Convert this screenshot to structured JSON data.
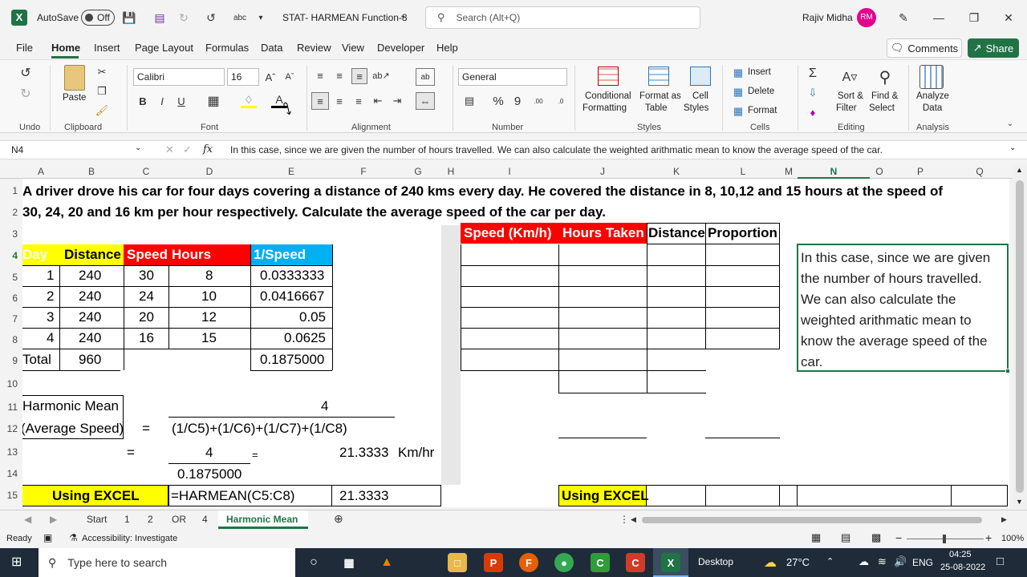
{
  "titlebar": {
    "autosave_label": "AutoSave",
    "autosave_state": "Off",
    "doc_title": "STAT- HARMEAN Function-8",
    "search_placeholder": "Search (Alt+Q)",
    "user_name": "Rajiv Midha",
    "user_initials": "RM"
  },
  "menu": {
    "tabs": [
      "File",
      "Home",
      "Insert",
      "Page Layout",
      "Formulas",
      "Data",
      "Review",
      "View",
      "Developer",
      "Help"
    ],
    "comments": "Comments",
    "share": "Share"
  },
  "ribbon": {
    "font_name": "Calibri",
    "font_size": "16",
    "number_format": "General",
    "paste": "Paste",
    "groups": [
      "Undo",
      "Clipboard",
      "Font",
      "Alignment",
      "Number",
      "Styles",
      "Cells",
      "Editing",
      "Analysis"
    ],
    "cond_format": [
      "Conditional",
      "Formatting"
    ],
    "format_table": [
      "Format as",
      "Table"
    ],
    "cell_styles": [
      "Cell",
      "Styles"
    ],
    "insert": "Insert",
    "delete": "Delete",
    "format": "Format",
    "sort_filter": [
      "Sort &",
      "Filter"
    ],
    "find_select": [
      "Find &",
      "Select"
    ],
    "analyze": [
      "Analyze",
      "Data"
    ]
  },
  "formula_bar": {
    "name_box": "N4",
    "fx": "fx",
    "content": "In this case, since we are given the number of hours travelled. We can also calculate the weighted arithmatic mean to know the average speed of the car."
  },
  "columns": [
    "A",
    "B",
    "C",
    "D",
    "E",
    "F",
    "G",
    "H",
    "I",
    "J",
    "K",
    "L",
    "M",
    "N",
    "O",
    "P",
    "Q"
  ],
  "rows": [
    "1",
    "2",
    "3",
    "4",
    "5",
    "6",
    "7",
    "8",
    "9",
    "10",
    "11",
    "12",
    "13",
    "14",
    "15"
  ],
  "sheet": {
    "row1": "A driver drove his car for four days covering a distance of 240 kms every day. He covered the distance in 8, 10,12 and 15 hours at the speed of",
    "row2": "30, 24, 20 and 16 km per hour respectively. Calculate  the average speed of the car per day.",
    "headers": [
      "Day",
      "Distance",
      "Speed",
      "Hours",
      "1/Speed"
    ],
    "data": [
      [
        "1",
        "240",
        "30",
        "8",
        "0.0333333"
      ],
      [
        "2",
        "240",
        "24",
        "10",
        "0.0416667"
      ],
      [
        "3",
        "240",
        "20",
        "12",
        "0.05"
      ],
      [
        "4",
        "240",
        "16",
        "15",
        "0.0625"
      ]
    ],
    "total": [
      "Total",
      "960",
      "0.1875000"
    ],
    "hm_label1": "Harmonic Mean",
    "hm_label2": "(Average Speed)",
    "eq": "=",
    "eq2": "=",
    "eq3": "=",
    "num4": "4",
    "denom_formula": "(1/C5)+(1/C6)+(1/C7)+(1/C8)",
    "num4b": "4",
    "result": "21.3333",
    "unit": "Km/hr",
    "denom_val": "0.1875000",
    "using_excel": "Using EXCEL",
    "formula": "=HARMEAN(C5:C8)",
    "result2": "21.3333",
    "right_headers": [
      "Speed (Km/h)",
      "Hours Taken",
      "Distance",
      "Proportion"
    ],
    "using_excel2": "Using EXCEL",
    "note": "In this case, since we are given the number of hours travelled. We can also calculate the weighted arithmatic mean to know the average speed of the car."
  },
  "sheet_tabs": [
    "Start",
    "1",
    "2",
    "OR",
    "4",
    "Harmonic Mean"
  ],
  "status": {
    "ready": "Ready",
    "accessibility": "Accessibility: Investigate",
    "zoom": "100%"
  },
  "taskbar": {
    "search": "Type here to search",
    "desktop": "Desktop",
    "temp": "27°C",
    "lang": "ENG",
    "time": "04:25",
    "date": "25-08-2022"
  },
  "colors": {
    "excel_green": "#217346",
    "yellow": "#ffff00",
    "red": "#ff0000",
    "blue": "#00b0f0",
    "taskbar": "#1f2b38"
  }
}
